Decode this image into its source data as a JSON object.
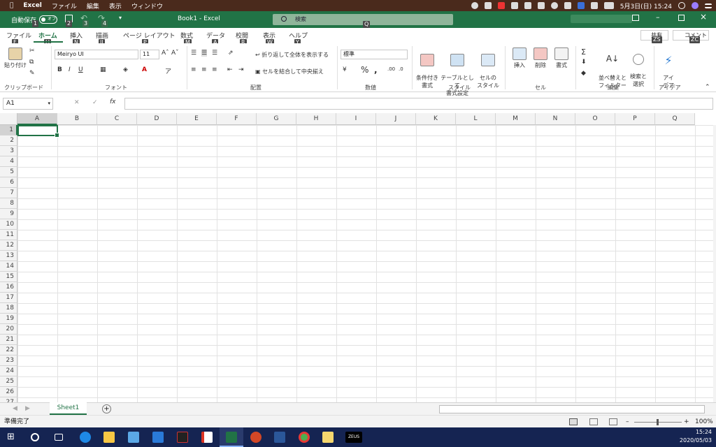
{
  "menubar": {
    "apple": "",
    "app": "Excel",
    "items": [
      "ファイル",
      "編集",
      "表示",
      "ウィンドウ"
    ],
    "clock": "5月3日(日) 15:24"
  },
  "titlebar": {
    "autosave_label": "自動保存",
    "autosave_state": "オフ",
    "doc_title": "Book1  -  Excel",
    "search_placeholder": "検索",
    "keytips": {
      "autosave": "1",
      "save": "2",
      "undo": "3",
      "redo": "4",
      "search": "Q"
    }
  },
  "ribbon": {
    "tabs": [
      {
        "label": "ファイル",
        "keytip": "F"
      },
      {
        "label": "ホーム",
        "keytip": "H"
      },
      {
        "label": "挿入",
        "keytip": "N"
      },
      {
        "label": "描画",
        "keytip": "JI"
      },
      {
        "label": "ページ レイアウト",
        "keytip": "P"
      },
      {
        "label": "数式",
        "keytip": "M"
      },
      {
        "label": "データ",
        "keytip": "A"
      },
      {
        "label": "校閲",
        "keytip": "R"
      },
      {
        "label": "表示",
        "keytip": "W"
      },
      {
        "label": "ヘルプ",
        "keytip": "Y"
      }
    ],
    "share_label": "共有",
    "share_keytip": "ZS",
    "comment_label": "コメント",
    "comment_keytip": "ZC",
    "clipboard": {
      "paste": "貼り付け",
      "group": "クリップボード"
    },
    "font": {
      "name": "Meiryo UI",
      "size": "11",
      "group": "フォント"
    },
    "alignment": {
      "wrap": "折り返して全体を表示する",
      "merge": "セルを結合して中央揃え",
      "group": "配置"
    },
    "number": {
      "format": "標準",
      "group": "数値"
    },
    "styles": {
      "conditional": "条件付き\n書式",
      "table": "テーブルとして\n書式設定",
      "cell": "セルの\nスタイル",
      "group": "スタイル"
    },
    "cells": {
      "insert": "挿入",
      "delete": "削除",
      "format": "書式",
      "group": "セル"
    },
    "editing": {
      "sort": "並べ替えと\nフィルター",
      "find": "検索と\n選択",
      "group": "編集"
    },
    "ideas": {
      "label": "アイ\nデア",
      "group": "アイデア"
    }
  },
  "formula_bar": {
    "name_box": "A1",
    "fx": "fx",
    "value": ""
  },
  "grid": {
    "columns": [
      "A",
      "B",
      "C",
      "D",
      "E",
      "F",
      "G",
      "H",
      "I",
      "J",
      "K",
      "L",
      "M",
      "N",
      "O",
      "P",
      "Q"
    ],
    "rows": [
      "1",
      "2",
      "3",
      "4",
      "5",
      "6",
      "7",
      "8",
      "9",
      "10",
      "11",
      "12",
      "13",
      "14",
      "15",
      "16",
      "17",
      "18",
      "19",
      "20",
      "21",
      "22",
      "23",
      "24",
      "25",
      "26",
      "27"
    ]
  },
  "sheets": {
    "tabs": [
      "Sheet1"
    ],
    "active": "Sheet1",
    "add": "+"
  },
  "status": {
    "text": "準備完了",
    "zoom": "100%"
  },
  "taskbar": {
    "time": "15:24",
    "date": "2020/05/03",
    "zeus_label": "ZEUS"
  }
}
